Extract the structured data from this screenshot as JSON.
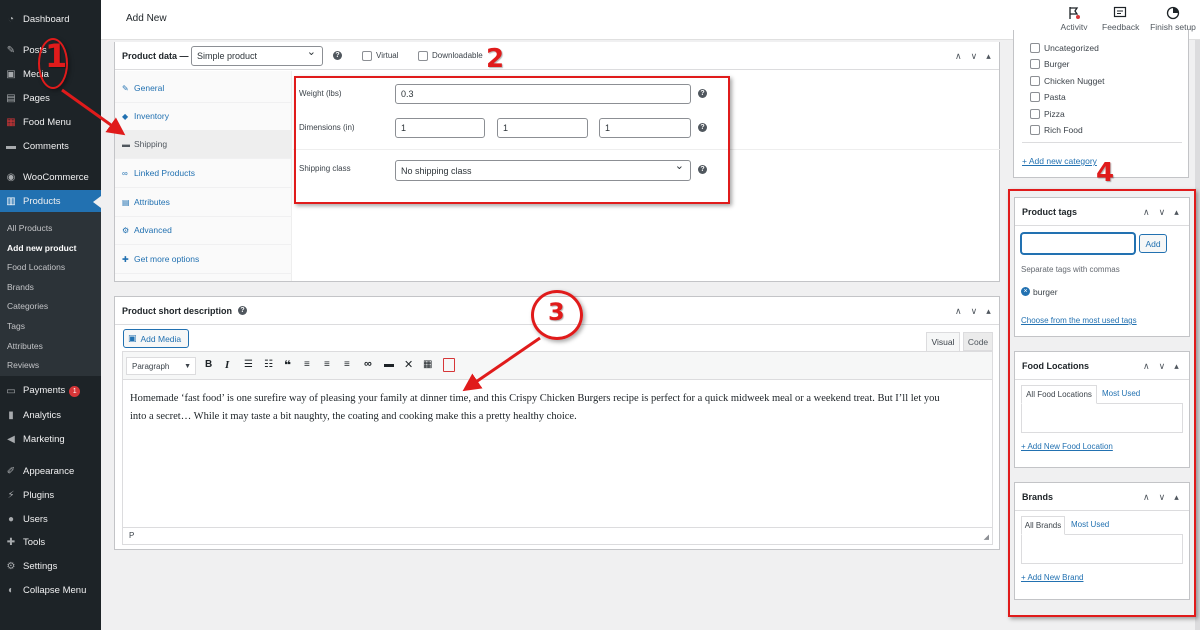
{
  "sidebar": {
    "items": [
      {
        "label": "Dashboard",
        "icon": "dashboard-icon"
      },
      {
        "label": "Posts",
        "icon": "pin-icon"
      },
      {
        "label": "Media",
        "icon": "media-icon"
      },
      {
        "label": "Pages",
        "icon": "pages-icon"
      },
      {
        "label": "Food Menu",
        "icon": "menu-icon"
      },
      {
        "label": "Comments",
        "icon": "comments-icon"
      },
      {
        "label": "WooCommerce",
        "icon": "woocommerce-icon"
      },
      {
        "label": "Products",
        "icon": "products-icon"
      },
      {
        "label": "Payments",
        "icon": "payments-icon",
        "badge": "1"
      },
      {
        "label": "Analytics",
        "icon": "analytics-icon"
      },
      {
        "label": "Marketing",
        "icon": "marketing-icon"
      },
      {
        "label": "Appearance",
        "icon": "appearance-icon"
      },
      {
        "label": "Plugins",
        "icon": "plugins-icon"
      },
      {
        "label": "Users",
        "icon": "users-icon"
      },
      {
        "label": "Tools",
        "icon": "tools-icon"
      },
      {
        "label": "Settings",
        "icon": "settings-icon"
      },
      {
        "label": "Collapse Menu",
        "icon": "collapse-icon"
      }
    ],
    "submenu": [
      "All Products",
      "Add new product",
      "Food Locations",
      "Brands",
      "Categories",
      "Tags",
      "Attributes",
      "Reviews"
    ]
  },
  "topbar": {
    "title": "Add New",
    "activity": "Activity",
    "feedback": "Feedback",
    "finish_setup": "Finish setup"
  },
  "product_data": {
    "label": "Product data —",
    "type_value": "Simple product",
    "virtual": "Virtual",
    "downloadable": "Downloadable",
    "tabs": [
      "General",
      "Inventory",
      "Shipping",
      "Linked Products",
      "Attributes",
      "Advanced",
      "Get more options"
    ],
    "weight_label": "Weight (lbs)",
    "weight_value": "0.3",
    "dimensions_label": "Dimensions (in)",
    "length": "1",
    "width": "1",
    "height": "1",
    "shipping_class_label": "Shipping class",
    "shipping_class_value": "No shipping class"
  },
  "short_desc": {
    "title": "Product short description",
    "add_media": "Add Media",
    "visual": "Visual",
    "code": "Code",
    "format": "Paragraph",
    "text_line1": "Homemade ‘fast food’ is one surefire way of pleasing your family at dinner time, and this Crispy Chicken Burgers recipe is perfect for a quick midweek meal or a weekend treat. But I’ll let you",
    "text_line2": "into a secret… While it may taste a bit naughty, the coating and cooking make this a pretty healthy choice.",
    "path": "P"
  },
  "categories": {
    "items": [
      "Uncategorized",
      "Burger",
      "Chicken Nugget",
      "Pasta",
      "Pizza",
      "Rich Food"
    ],
    "add_new": "+ Add new category"
  },
  "tags": {
    "title": "Product tags",
    "add": "Add",
    "hint": "Separate tags with commas",
    "tag": "burger",
    "choose": "Choose from the most used tags"
  },
  "food_locations": {
    "title": "Food Locations",
    "tab_all": "All Food Locations",
    "tab_most": "Most Used",
    "add_new": "+ Add New Food Location"
  },
  "brands": {
    "title": "Brands",
    "tab_all": "All Brands",
    "tab_most": "Most Used",
    "add_new": "+ Add New Brand"
  },
  "annotations": {
    "n1": "1",
    "n2": "2",
    "n3": "3",
    "n4": "4"
  },
  "colors": {
    "sidebar_bg": "#1d2327",
    "accent": "#2271b1",
    "annotation": "#e01b1b"
  }
}
